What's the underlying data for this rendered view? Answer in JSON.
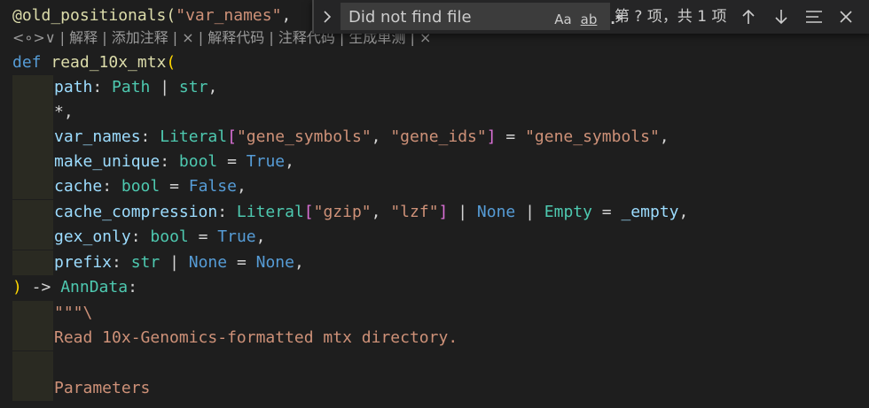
{
  "editor": {
    "decorator_prefix": "@old_positionals(",
    "decorator_arg": "\"var_names\"",
    "decorator_comma": ",",
    "codelens": {
      "icon_label": "<∘>∨",
      "items": [
        "解释",
        "添加注释",
        "×",
        "解释代码",
        "注释代码",
        "生成单测",
        "×"
      ],
      "separator": " | "
    },
    "lines": {
      "def_kw": "def",
      "func_name": "read_10x_mtx",
      "open_paren": "(",
      "p_path": "path",
      "p_path_type1": "Path",
      "p_path_type2": "str",
      "star": "*,",
      "p_var_names": "var_names",
      "t_literal": "Literal",
      "s_gene_symbols": "\"gene_symbols\"",
      "s_gene_ids": "\"gene_ids\"",
      "p_make_unique": "make_unique",
      "t_bool": "bool",
      "v_true": "True",
      "p_cache": "cache",
      "v_false": "False",
      "p_cache_compression": "cache_compression",
      "s_gzip": "\"gzip\"",
      "s_lzf": "\"lzf\"",
      "v_none": "None",
      "t_empty": "Empty",
      "v_empty": "_empty",
      "p_gex_only": "gex_only",
      "p_prefix": "prefix",
      "t_str": "str",
      "close_paren": ")",
      "arrow": " -> ",
      "ret_type": "AnnData",
      "colon": ":",
      "doc_open": "\"\"\"\\",
      "doc_line1": "Read 10x-Genomics-formatted mtx directory.",
      "doc_params": "Parameters"
    }
  },
  "find": {
    "search_value": "Did not find file",
    "match_case_label": "Aa",
    "whole_word_label": "ab",
    "regex_label": ".*",
    "match_count": "第 ? 项，共 1 项",
    "prev_icon": "arrow-up-icon",
    "next_icon": "arrow-down-icon",
    "selection_icon": "find-in-selection-icon",
    "close_icon": "close-icon"
  }
}
